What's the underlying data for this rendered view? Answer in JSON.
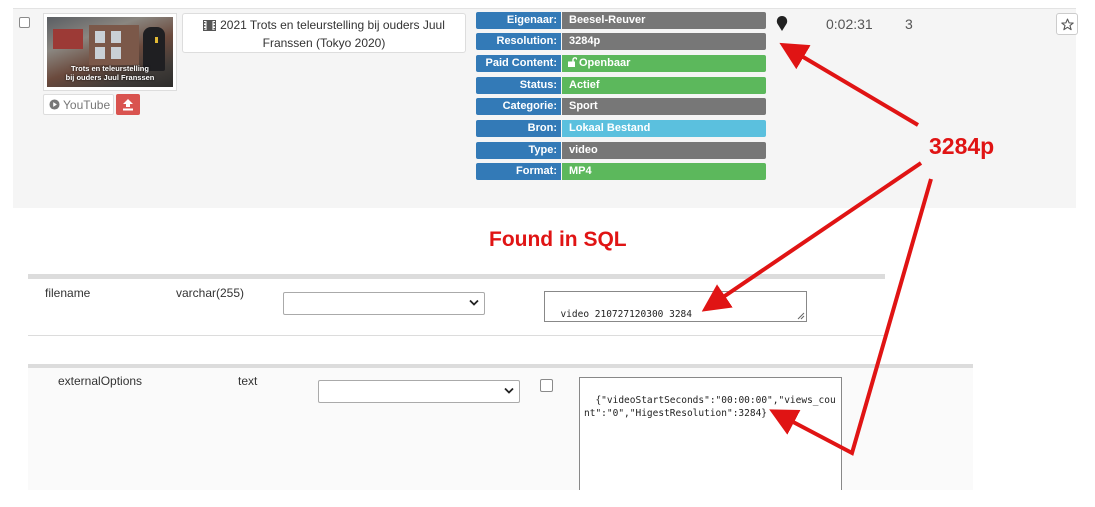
{
  "media_row": {
    "title_line1": "2021 Trots en teleurstelling bij ouders Juul",
    "title_line2": "Franssen (Tokyo 2020)",
    "thumbnail_caption": "Trots en teleurstelling\nbij ouders Juul Franssen",
    "youtube_label": "YouTube",
    "duration": "0:02:31",
    "count": "3",
    "properties": [
      {
        "label": "Eigenaar:",
        "value": "Beesel-Reuver",
        "color": "#777777"
      },
      {
        "label": "Resolution:",
        "value": "3284p",
        "color": "#777777"
      },
      {
        "label": "Paid Content:",
        "value": "Openbaar",
        "color": "#5cb85c",
        "icon": "unlock-icon"
      },
      {
        "label": "Status:",
        "value": "Actief",
        "color": "#5cb85c"
      },
      {
        "label": "Categorie:",
        "value": "Sport",
        "color": "#777777"
      },
      {
        "label": "Bron:",
        "value": "Lokaal Bestand",
        "color": "#5bc0de"
      },
      {
        "label": "Type:",
        "value": "video",
        "color": "#777777"
      },
      {
        "label": "Format:",
        "value": "MP4",
        "color": "#5cb85c"
      }
    ],
    "icons": {
      "location": "map-pin-icon",
      "favorite": "star-icon",
      "upload": "upload-icon",
      "youtube": "play-circle-icon",
      "film": "film-icon"
    }
  },
  "sql": {
    "rows": [
      {
        "field": "filename",
        "type": "varchar(255)",
        "value": "video 210727120300 3284"
      },
      {
        "field": "externalOptions",
        "type": "text",
        "value": "{\"videoStartSeconds\":\"00:00:00\",\"views_count\":\"0\",\"HigestResolution\":3284}"
      }
    ]
  },
  "annotations": {
    "found_label": "Found in SQL",
    "resolution_label": "3284p",
    "color": "#e01414"
  }
}
